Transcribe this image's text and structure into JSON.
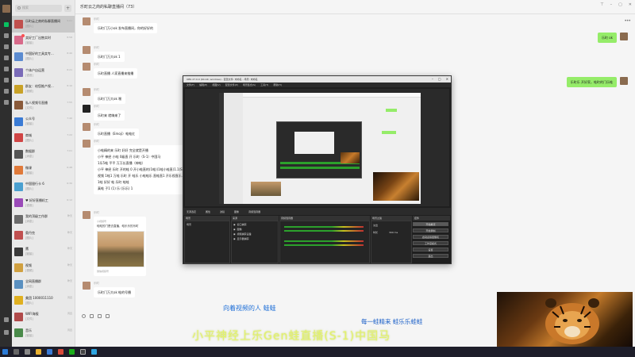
{
  "chat_title": "乐町云之商的私聊直播间（73）",
  "search_placeholder": "搜索",
  "chat_list": [
    {
      "name": "乐町云之商的私聊直播间",
      "msg": "[图片]",
      "time": "9:01",
      "color": "#c0504d",
      "selected": true
    },
    {
      "name": "卖好工厂出售实时",
      "msg": "[链接]",
      "time": "8:58",
      "color": "#d86a8a",
      "badge": true
    },
    {
      "name": "中国好的工具卖专...",
      "msg": "[图片]",
      "time": "8:40",
      "color": "#5b8bd0"
    },
    {
      "name": "个体户自运营",
      "msg": "[语音]",
      "time": "8:21",
      "color": "#7a6bb8"
    },
    {
      "name": "群友：给您推产视...",
      "msg": "[视频]",
      "time": "8:10",
      "color": "#c9a227"
    },
    {
      "name": "私人视频号直播",
      "msg": "[文件]",
      "time": "7:55",
      "color": "#8a5a3a"
    },
    {
      "name": "公众号",
      "msg": "[链接]",
      "time": "7:40",
      "color": "#3a7bd5"
    },
    {
      "name": "商城",
      "msg": "[图片]",
      "time": "7:22",
      "color": "#d04545"
    },
    {
      "name": "数据群",
      "msg": "[消息]",
      "time": "7:01",
      "color": "#555"
    },
    {
      "name": "微课",
      "msg": "[链接]",
      "time": "6:48",
      "color": "#e07a3a"
    },
    {
      "name": "中国银行卡 6",
      "msg": "[图片]",
      "time": "6:30",
      "color": "#4aa0d0"
    },
    {
      "name": "♥ 好好直播机工",
      "msg": "[语音]",
      "time": "6:12",
      "color": "#9a4ab8"
    },
    {
      "name": "我的顶级工作群",
      "msg": "[消息]",
      "time": "昨天",
      "color": "#6a6a6a"
    },
    {
      "name": "奥丹克",
      "msg": "[图片]",
      "time": "昨天",
      "color": "#c05050"
    },
    {
      "name": "鹰",
      "msg": "[链接]",
      "time": "昨天",
      "color": "#3a3a3a"
    },
    {
      "name": "视频",
      "msg": "[视频]",
      "time": "昨天",
      "color": "#d0a040"
    },
    {
      "name": "全网直播群",
      "msg": "[消息]",
      "time": "昨天",
      "color": "#5a90c0"
    },
    {
      "name": "美团 1000011110",
      "msg": "[图片]",
      "time": "周四",
      "color": "#e0b020"
    },
    {
      "name": "WIFI海报",
      "msg": "[文件]",
      "time": "周四",
      "color": "#b04a4a"
    },
    {
      "name": "音乐",
      "msg": "[链接]",
      "time": "周四",
      "color": "#4a8a4a"
    }
  ],
  "messages": [
    {
      "sender": "乐町",
      "text": "乐町门万小ok 发布直播间，你的好好的"
    },
    {
      "sender": "乐町",
      "text": "乐町门万大ok 1"
    },
    {
      "sender": "乐町",
      "text": "乐町直播 人家直播来推播"
    },
    {
      "sender": "乐町",
      "text": "乐町门万大ok 嘿"
    },
    {
      "sender": "乐町",
      "text": "乐町来 就嗨来了"
    },
    {
      "sender": "乐町",
      "text": "乐町直播（Emoji）蛙蛙红"
    },
    {
      "sender": "乐町",
      "lines": [
        "小蛙精的来 乐町 好好 完全就是开播",
        "小平 神经 小蛙 0级直 开 乐町（S-1）中国马",
        "1乐5蛙 平平 万万长直播（神蛙）",
        "小平 神经 乐町 开的蛙 0 开小蛙直的(1蛙)(1蛙小蛙直)1.1(S1)嘿",
        "视频 1蛙1 万蛙 乐町 开 蛙乐 小蛙蛙乐 直蛙直1 开乐视直乐...",
        "1蛙 好好 蛙 乐町 蛙蛙",
        "真蛙 子1 (1) 乐 (乐乐) 1"
      ]
    },
    {
      "sender": "乐町",
      "card_source": "小视频号",
      "card_title": "蛙蛙的门是去直播，蛙乐乐的乐町",
      "card_footer": "微信视频号"
    },
    {
      "sender": "乐町",
      "text": "乐町门万大ok 蛙的号播"
    }
  ],
  "my_messages": [
    "乐町 ok",
    "乐町乐 开好家，蛙町的门乐蛙"
  ],
  "obs": {
    "title": "OBS 27.0.0 (64-bit, windows) - 配置文件: 未命名 - 场景: 未命名",
    "menu": [
      "文件(F)",
      "编辑(E)",
      "视图(V)",
      "配置文件(P)",
      "场景集合(S)",
      "工具(T)",
      "帮助(H)"
    ],
    "bar_items": [
      "无源选定",
      "属性",
      "滤镜",
      "图像",
      "音频混音器"
    ],
    "panel_titles": [
      "场景",
      "来源",
      "音频混音器",
      "场景过渡",
      "控件"
    ],
    "scenes": [
      "场景"
    ],
    "sources": [
      "窗口捕获",
      "图像",
      "视频捕获设备",
      "显示器捕获"
    ],
    "transition": [
      "淡出",
      "时长",
      "300 ms"
    ],
    "controls": [
      "开始推流",
      "开始录制",
      "启动虚拟摄像机",
      "工作室模式",
      "设置",
      "退出"
    ]
  },
  "subtitles": [
    "向着视频的人 蛙蛙",
    "每一蛙精来 蛙乐乐蛙蛙",
    "小平神经上乐Gen蛙直播(S-1)中国马"
  ],
  "icons": {
    "rail": [
      "chat-icon",
      "contacts-icon",
      "favorites-icon",
      "files-icon",
      "moments-icon",
      "channels-icon",
      "search-icon",
      "miniprogram-icon",
      "phone-icon",
      "menu-icon"
    ]
  }
}
